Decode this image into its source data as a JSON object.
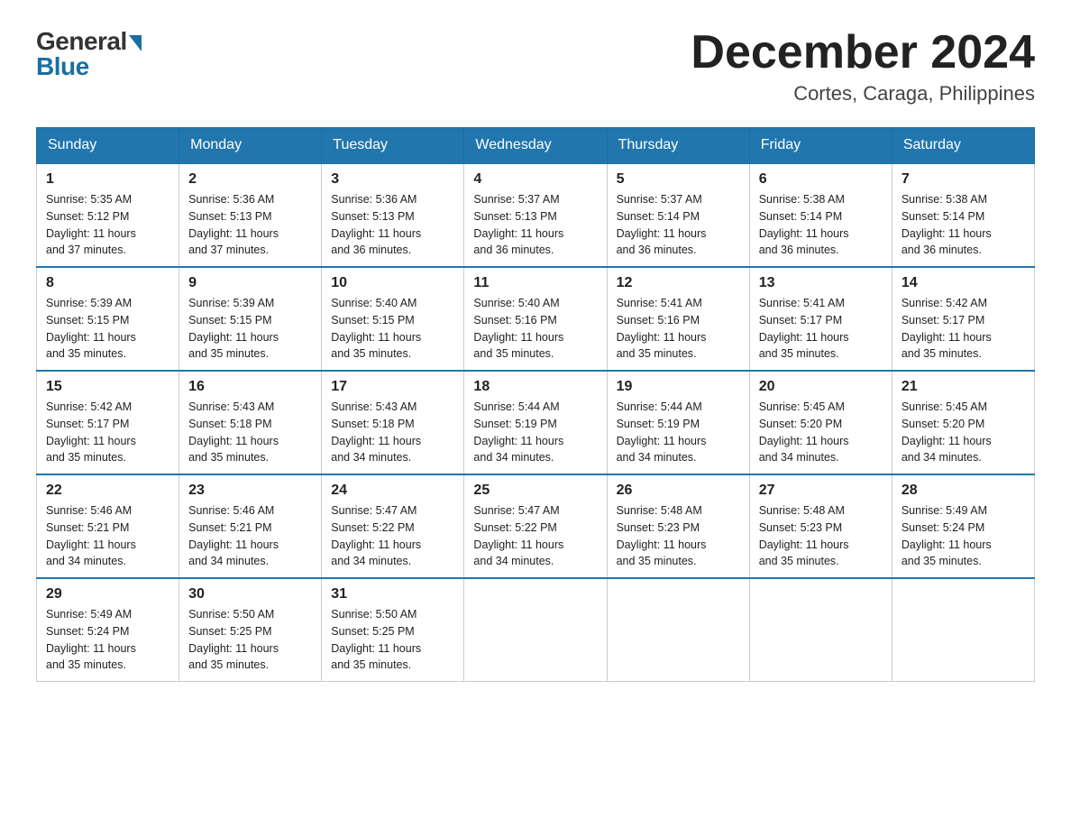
{
  "header": {
    "logo_general": "General",
    "logo_blue": "Blue",
    "month_title": "December 2024",
    "location": "Cortes, Caraga, Philippines"
  },
  "days_of_week": [
    "Sunday",
    "Monday",
    "Tuesday",
    "Wednesday",
    "Thursday",
    "Friday",
    "Saturday"
  ],
  "weeks": [
    [
      {
        "day": "1",
        "sunrise": "5:35 AM",
        "sunset": "5:12 PM",
        "daylight": "11 hours and 37 minutes."
      },
      {
        "day": "2",
        "sunrise": "5:36 AM",
        "sunset": "5:13 PM",
        "daylight": "11 hours and 37 minutes."
      },
      {
        "day": "3",
        "sunrise": "5:36 AM",
        "sunset": "5:13 PM",
        "daylight": "11 hours and 36 minutes."
      },
      {
        "day": "4",
        "sunrise": "5:37 AM",
        "sunset": "5:13 PM",
        "daylight": "11 hours and 36 minutes."
      },
      {
        "day": "5",
        "sunrise": "5:37 AM",
        "sunset": "5:14 PM",
        "daylight": "11 hours and 36 minutes."
      },
      {
        "day": "6",
        "sunrise": "5:38 AM",
        "sunset": "5:14 PM",
        "daylight": "11 hours and 36 minutes."
      },
      {
        "day": "7",
        "sunrise": "5:38 AM",
        "sunset": "5:14 PM",
        "daylight": "11 hours and 36 minutes."
      }
    ],
    [
      {
        "day": "8",
        "sunrise": "5:39 AM",
        "sunset": "5:15 PM",
        "daylight": "11 hours and 35 minutes."
      },
      {
        "day": "9",
        "sunrise": "5:39 AM",
        "sunset": "5:15 PM",
        "daylight": "11 hours and 35 minutes."
      },
      {
        "day": "10",
        "sunrise": "5:40 AM",
        "sunset": "5:15 PM",
        "daylight": "11 hours and 35 minutes."
      },
      {
        "day": "11",
        "sunrise": "5:40 AM",
        "sunset": "5:16 PM",
        "daylight": "11 hours and 35 minutes."
      },
      {
        "day": "12",
        "sunrise": "5:41 AM",
        "sunset": "5:16 PM",
        "daylight": "11 hours and 35 minutes."
      },
      {
        "day": "13",
        "sunrise": "5:41 AM",
        "sunset": "5:17 PM",
        "daylight": "11 hours and 35 minutes."
      },
      {
        "day": "14",
        "sunrise": "5:42 AM",
        "sunset": "5:17 PM",
        "daylight": "11 hours and 35 minutes."
      }
    ],
    [
      {
        "day": "15",
        "sunrise": "5:42 AM",
        "sunset": "5:17 PM",
        "daylight": "11 hours and 35 minutes."
      },
      {
        "day": "16",
        "sunrise": "5:43 AM",
        "sunset": "5:18 PM",
        "daylight": "11 hours and 35 minutes."
      },
      {
        "day": "17",
        "sunrise": "5:43 AM",
        "sunset": "5:18 PM",
        "daylight": "11 hours and 34 minutes."
      },
      {
        "day": "18",
        "sunrise": "5:44 AM",
        "sunset": "5:19 PM",
        "daylight": "11 hours and 34 minutes."
      },
      {
        "day": "19",
        "sunrise": "5:44 AM",
        "sunset": "5:19 PM",
        "daylight": "11 hours and 34 minutes."
      },
      {
        "day": "20",
        "sunrise": "5:45 AM",
        "sunset": "5:20 PM",
        "daylight": "11 hours and 34 minutes."
      },
      {
        "day": "21",
        "sunrise": "5:45 AM",
        "sunset": "5:20 PM",
        "daylight": "11 hours and 34 minutes."
      }
    ],
    [
      {
        "day": "22",
        "sunrise": "5:46 AM",
        "sunset": "5:21 PM",
        "daylight": "11 hours and 34 minutes."
      },
      {
        "day": "23",
        "sunrise": "5:46 AM",
        "sunset": "5:21 PM",
        "daylight": "11 hours and 34 minutes."
      },
      {
        "day": "24",
        "sunrise": "5:47 AM",
        "sunset": "5:22 PM",
        "daylight": "11 hours and 34 minutes."
      },
      {
        "day": "25",
        "sunrise": "5:47 AM",
        "sunset": "5:22 PM",
        "daylight": "11 hours and 34 minutes."
      },
      {
        "day": "26",
        "sunrise": "5:48 AM",
        "sunset": "5:23 PM",
        "daylight": "11 hours and 35 minutes."
      },
      {
        "day": "27",
        "sunrise": "5:48 AM",
        "sunset": "5:23 PM",
        "daylight": "11 hours and 35 minutes."
      },
      {
        "day": "28",
        "sunrise": "5:49 AM",
        "sunset": "5:24 PM",
        "daylight": "11 hours and 35 minutes."
      }
    ],
    [
      {
        "day": "29",
        "sunrise": "5:49 AM",
        "sunset": "5:24 PM",
        "daylight": "11 hours and 35 minutes."
      },
      {
        "day": "30",
        "sunrise": "5:50 AM",
        "sunset": "5:25 PM",
        "daylight": "11 hours and 35 minutes."
      },
      {
        "day": "31",
        "sunrise": "5:50 AM",
        "sunset": "5:25 PM",
        "daylight": "11 hours and 35 minutes."
      },
      null,
      null,
      null,
      null
    ]
  ],
  "labels": {
    "sunrise": "Sunrise:",
    "sunset": "Sunset:",
    "daylight": "Daylight:"
  }
}
